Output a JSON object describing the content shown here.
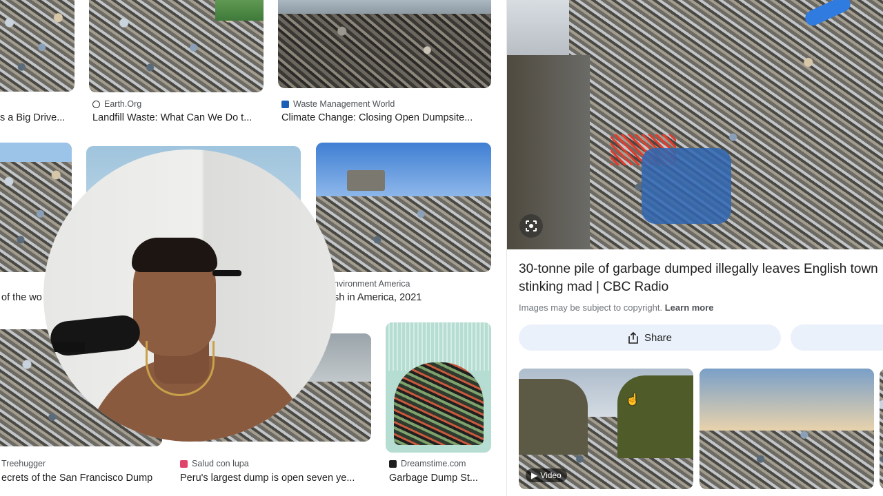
{
  "results": [
    {
      "id": "r1c1",
      "source": "",
      "title": "s a Big Drive..."
    },
    {
      "id": "r1c2",
      "source": "Earth.Org",
      "title": "Landfill Waste: What Can We Do t..."
    },
    {
      "id": "r1c3",
      "source": "Waste Management World",
      "title": "Climate Change: Closing Open Dumpsite..."
    },
    {
      "id": "r2c1",
      "source": "",
      "title": "of the wo"
    },
    {
      "id": "r2c3",
      "source": "nvironment America",
      "title": "sh in America, 2021"
    },
    {
      "id": "r3c1",
      "source": "Treehugger",
      "title": "ecrets of the San Francisco Dump"
    },
    {
      "id": "r3c2",
      "source": "Salud con lupa",
      "title": "Peru's largest dump is open seven ye..."
    },
    {
      "id": "r3c3",
      "source": "Dreamstime.com",
      "title": "Garbage Dump St..."
    }
  ],
  "panel": {
    "title": "30-tonne pile of garbage dumped illegally leaves English town stinking mad | CBC Radio",
    "copyright_text": "Images may be subject to copyright.",
    "learn_more": "Learn more",
    "share_label": "Share",
    "video_label": "Video"
  },
  "icons": {
    "lens": "google-lens-icon",
    "share": "share-icon",
    "play": "play-icon",
    "cursor": "hand-cursor-icon"
  },
  "colors": {
    "pill_bg": "#eaf1fb",
    "meta_text": "#70757a",
    "earth_org": "#333333",
    "wmw": "#1a5fb4",
    "salud": "#e0446a"
  }
}
